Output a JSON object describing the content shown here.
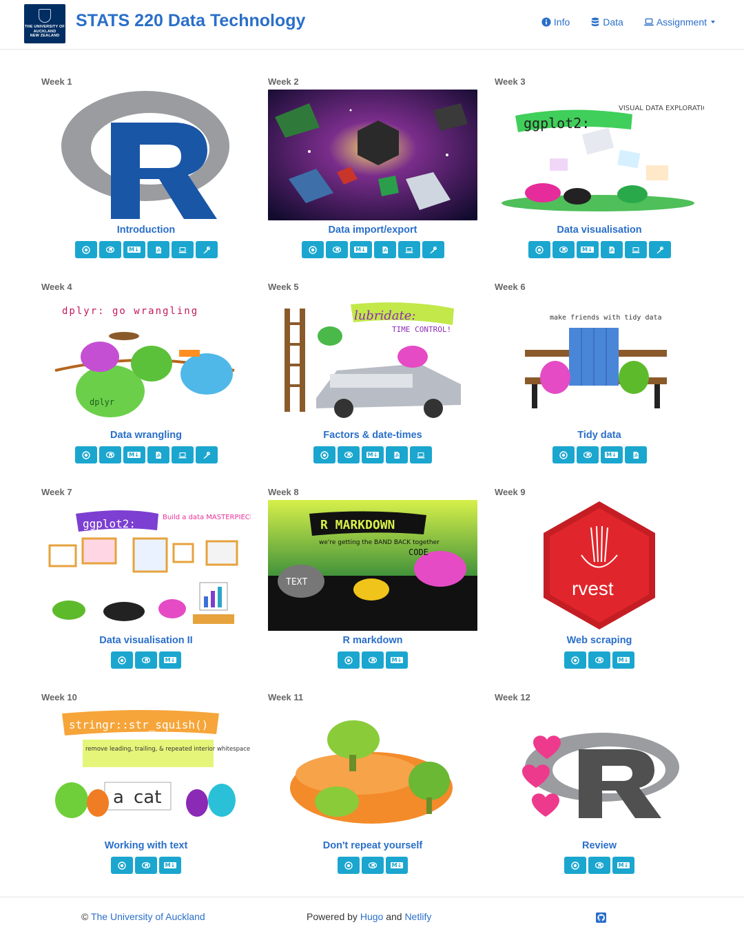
{
  "site": {
    "title": "STATS 220 Data Technology",
    "logo_text": [
      "THE UNIVERSITY OF",
      "AUCKLAND",
      "NEW ZEALAND"
    ],
    "nav": [
      {
        "label": "Info",
        "icon": "info-circle-icon"
      },
      {
        "label": "Data",
        "icon": "database-icon"
      },
      {
        "label": "Assignment",
        "icon": "laptop-icon",
        "dropdown": true
      }
    ]
  },
  "weeks": [
    {
      "week": "Week 1",
      "title": "Introduction",
      "buttons": [
        "target",
        "r",
        "markdown",
        "pdf",
        "laptop",
        "key"
      ]
    },
    {
      "week": "Week 2",
      "title": "Data import/export",
      "buttons": [
        "target",
        "r",
        "markdown",
        "pdf",
        "laptop",
        "key"
      ]
    },
    {
      "week": "Week 3",
      "title": "Data visualisation",
      "buttons": [
        "target",
        "r",
        "markdown",
        "pdf",
        "laptop",
        "key"
      ],
      "art": [
        "ggplot2:",
        "VISUAL DATA EXPLORATION"
      ]
    },
    {
      "week": "Week 4",
      "title": "Data wrangling",
      "buttons": [
        "target",
        "r",
        "markdown",
        "pdf",
        "laptop",
        "key"
      ],
      "art": [
        "dplyr: go wrangling",
        "dplyr"
      ]
    },
    {
      "week": "Week 5",
      "title": "Factors & date-times",
      "buttons": [
        "target",
        "r",
        "markdown",
        "pdf",
        "laptop"
      ],
      "art": [
        "lubridate:",
        "TIME CONTROL!"
      ]
    },
    {
      "week": "Week 6",
      "title": "Tidy data",
      "buttons": [
        "target",
        "r",
        "markdown",
        "pdf"
      ],
      "art": [
        "make friends with tidy data"
      ]
    },
    {
      "week": "Week 7",
      "title": "Data visualisation II",
      "buttons": [
        "target",
        "r",
        "markdown"
      ],
      "art": [
        "ggplot2:",
        "Build a data MASTERPIECE"
      ]
    },
    {
      "week": "Week 8",
      "title": "R markdown",
      "buttons": [
        "target",
        "r",
        "markdown"
      ],
      "art": [
        "R MARKDOWN",
        "we're getting the BAND BACK together",
        "TEXT",
        "CODE"
      ]
    },
    {
      "week": "Week 9",
      "title": "Web scraping",
      "buttons": [
        "target",
        "r",
        "markdown"
      ],
      "art": [
        "rvest"
      ]
    },
    {
      "week": "Week 10",
      "title": "Working with text",
      "buttons": [
        "target",
        "r",
        "markdown"
      ],
      "art": [
        "stringr::str_squish()",
        "remove leading, trailing, & repeated interior whitespace from strings",
        "a",
        "cat"
      ]
    },
    {
      "week": "Week 11",
      "title": "Don't repeat yourself",
      "buttons": [
        "target",
        "r",
        "markdown"
      ]
    },
    {
      "week": "Week 12",
      "title": "Review",
      "buttons": [
        "target",
        "r",
        "markdown"
      ]
    }
  ],
  "footer": {
    "copyright": "©",
    "university": "The University of Auckland",
    "powered_prefix": "Powered by",
    "hugo": "Hugo",
    "and": "and",
    "netlify": "Netlify",
    "github_icon": "github-icon"
  },
  "colors": {
    "accent": "#2a6fc9",
    "button": "#1ba6cf"
  }
}
